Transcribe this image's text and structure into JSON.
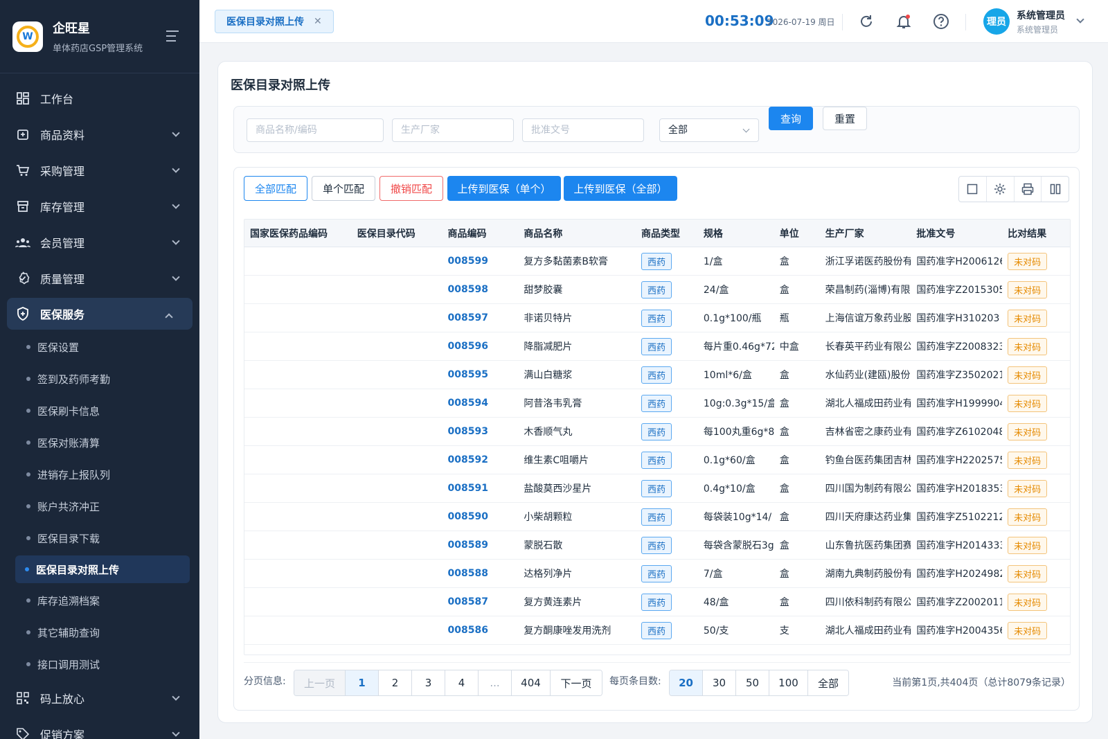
{
  "brand": {
    "name": "企旺星",
    "subtitle": "单体药店GSP管理系统"
  },
  "sidebar": {
    "items": [
      {
        "label": "工作台",
        "icon": "dashboard-icon"
      },
      {
        "label": "商品资料",
        "icon": "product-icon"
      },
      {
        "label": "采购管理",
        "icon": "cart-icon"
      },
      {
        "label": "库存管理",
        "icon": "inventory-icon"
      },
      {
        "label": "会员管理",
        "icon": "members-icon"
      },
      {
        "label": "质量管理",
        "icon": "quality-icon"
      },
      {
        "label": "医保服务",
        "icon": "shield-icon"
      }
    ],
    "sub_items": [
      "医保设置",
      "签到及药师考勤",
      "医保刷卡信息",
      "医保对账清算",
      "进销存上报队列",
      "账户共济冲正",
      "医保目录下载",
      "医保目录对照上传",
      "库存追溯档案",
      "其它辅助查询",
      "接口调用测试"
    ],
    "bottom_items": [
      {
        "label": "码上放心",
        "icon": "qrcode-icon"
      },
      {
        "label": "促销方案",
        "icon": "tag-icon"
      }
    ]
  },
  "header": {
    "tab_label": "医保目录对照上传",
    "time": "00:53:09",
    "date": "2026-07-19 周日",
    "avatar_text": "理员",
    "user_name": "系统管理员",
    "user_role": "系统管理员"
  },
  "page": {
    "title": "医保目录对照上传"
  },
  "filter": {
    "name_placeholder": "商品名称/编码",
    "maker_placeholder": "生产厂家",
    "approval_placeholder": "批准文号",
    "select_value": "全部",
    "query_label": "查询",
    "reset_label": "重置"
  },
  "toolbar": {
    "match_all": "全部匹配",
    "match_single": "单个匹配",
    "unmatch": "撤销匹配",
    "upload_single": "上传到医保（单个）",
    "upload_all": "上传到医保（全部）"
  },
  "table": {
    "headers": [
      "国家医保药品编码",
      "医保目录代码",
      "商品编码",
      "商品名称",
      "商品类型",
      "规格",
      "单位",
      "生产厂家",
      "批准文号",
      "比对结果"
    ],
    "rows": [
      {
        "code": "008599",
        "name": "复方多黏菌素B软膏",
        "type": "西药",
        "spec": "1/盒",
        "unit": "盒",
        "maker": "浙江孚诺医药股份有",
        "approval": "国药准字H2006126",
        "result": "未对码"
      },
      {
        "code": "008598",
        "name": "甜梦胶囊",
        "type": "西药",
        "spec": "24/盒",
        "unit": "盒",
        "maker": "荣昌制药(淄博)有限",
        "approval": "国药准字Z2015305",
        "result": "未对码"
      },
      {
        "code": "008597",
        "name": "非诺贝特片",
        "type": "西药",
        "spec": "0.1g*100/瓶",
        "unit": "瓶",
        "maker": "上海信谊万象药业股",
        "approval": "国药准字H310203",
        "result": "未对码"
      },
      {
        "code": "008596",
        "name": "降脂减肥片",
        "type": "西药",
        "spec": "每片重0.46g*72",
        "unit": "中盒",
        "maker": "长春英平药业有限公",
        "approval": "国药准字Z2008323",
        "result": "未对码"
      },
      {
        "code": "008595",
        "name": "满山白糖浆",
        "type": "西药",
        "spec": "10ml*6/盒",
        "unit": "盒",
        "maker": "水仙药业(建瓯)股份",
        "approval": "国药准字Z3502021",
        "result": "未对码"
      },
      {
        "code": "008594",
        "name": "阿昔洛韦乳膏",
        "type": "西药",
        "spec": "10g:0.3g*15/盒",
        "unit": "盒",
        "maker": "湖北人福成田药业有",
        "approval": "国药准字H1999904",
        "result": "未对码"
      },
      {
        "code": "008593",
        "name": "木香顺气丸",
        "type": "西药",
        "spec": "每100丸重6g*8",
        "unit": "盒",
        "maker": "吉林省密之康药业有",
        "approval": "国药准字Z6102048",
        "result": "未对码"
      },
      {
        "code": "008592",
        "name": "维生素C咀嚼片",
        "type": "西药",
        "spec": "0.1g*60/盒",
        "unit": "盒",
        "maker": "钓鱼台医药集团吉林",
        "approval": "国药准字H2202575",
        "result": "未对码"
      },
      {
        "code": "008591",
        "name": "盐酸莫西沙星片",
        "type": "西药",
        "spec": "0.4g*10/盒",
        "unit": "盒",
        "maker": "四川国为制药有限公",
        "approval": "国药准字H2018353",
        "result": "未对码"
      },
      {
        "code": "008590",
        "name": "小柴胡颗粒",
        "type": "西药",
        "spec": "每袋装10g*14/",
        "unit": "盒",
        "maker": "四川天府康达药业集",
        "approval": "国药准字Z5102212",
        "result": "未对码"
      },
      {
        "code": "008589",
        "name": "蒙脱石散",
        "type": "西药",
        "spec": "每袋含蒙脱石3g",
        "unit": "盒",
        "maker": "山东鲁抗医药集团赛",
        "approval": "国药准字H2014333",
        "result": "未对码"
      },
      {
        "code": "008588",
        "name": "达格列净片",
        "type": "西药",
        "spec": "7/盒",
        "unit": "盒",
        "maker": "湖南九典制药股份有",
        "approval": "国药准字H2024982",
        "result": "未对码"
      },
      {
        "code": "008587",
        "name": "复方黄连素片",
        "type": "西药",
        "spec": "48/盒",
        "unit": "盒",
        "maker": "四川依科制药有限公",
        "approval": "国药准字Z2002011",
        "result": "未对码"
      },
      {
        "code": "008586",
        "name": "复方酮康唑发用洗剂",
        "type": "西药",
        "spec": "50/支",
        "unit": "支",
        "maker": "湖北人福成田药业有",
        "approval": "国药准字H2004356",
        "result": "未对码"
      }
    ]
  },
  "pager": {
    "label": "分页信息:",
    "prev": "上一页",
    "pages": [
      "1",
      "2",
      "3",
      "4",
      "...",
      "404"
    ],
    "next": "下一页",
    "size_label": "每页条目数:",
    "sizes": [
      "20",
      "30",
      "50",
      "100",
      "全部"
    ],
    "summary": "当前第1页,共404页（总计8079条记录）"
  },
  "colors": {
    "primary": "#1c86ef",
    "sidebar_bg": "#1b2739",
    "warn": "#e58a00"
  }
}
